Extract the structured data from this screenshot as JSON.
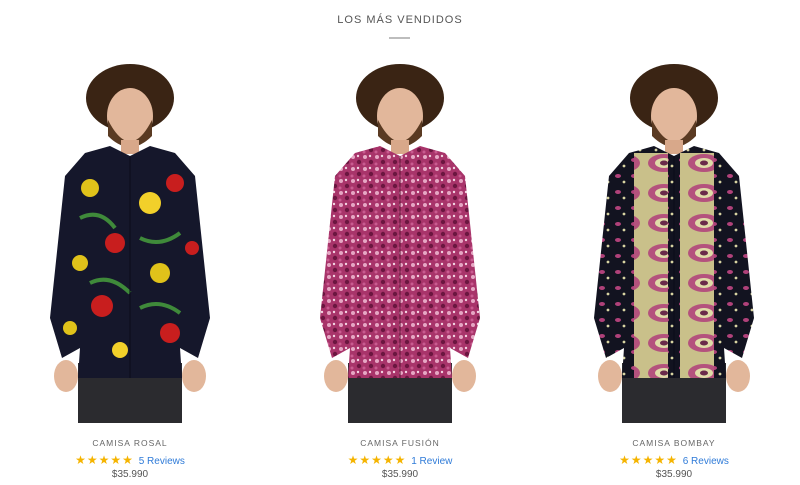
{
  "section": {
    "title": "LOS MÁS VENDIDOS"
  },
  "colors": {
    "star": "#f5b400",
    "link": "#2f7bd8"
  },
  "products": [
    {
      "name": "CAMISA ROSAL",
      "stars": "★★★★★",
      "rating": 5,
      "reviews": "5 Reviews",
      "price": "$35.990"
    },
    {
      "name": "CAMISA FUSIÓN",
      "stars": "★★★★★",
      "rating": 5,
      "reviews": "1 Review",
      "price": "$35.990"
    },
    {
      "name": "CAMISA BOMBAY",
      "stars": "★★★★★",
      "rating": 5,
      "reviews": "6 Reviews",
      "price": "$35.990"
    }
  ]
}
